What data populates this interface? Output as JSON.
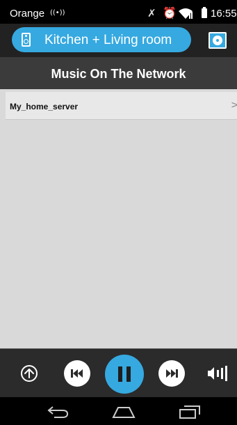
{
  "status_bar": {
    "carrier": "Orange",
    "broadcast_symbol": "((•))",
    "time": "16:55",
    "icons": [
      "broadcast-icon",
      "mute-icon",
      "alarm-icon",
      "wifi-icon",
      "signal-icon",
      "battery-icon"
    ]
  },
  "header": {
    "room_label": "Kitchen + Living room",
    "room_icon": "speaker-icon",
    "action_icon": "disc-icon",
    "accent_color": "#36a9e0"
  },
  "page": {
    "title": "Music On The Network"
  },
  "sources": [
    {
      "label": "My_home_server",
      "chevron": ">"
    }
  ],
  "player": {
    "controls": [
      "up-icon",
      "previous-icon",
      "pause-icon",
      "next-icon",
      "volume-icon"
    ],
    "state": "playing"
  },
  "nav": {
    "icons": [
      "back-icon",
      "home-icon",
      "recents-icon"
    ]
  }
}
